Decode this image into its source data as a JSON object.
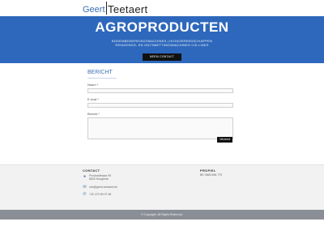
{
  "logo": {
    "first": "Geert",
    "last": "Teetaert"
  },
  "hero": {
    "title": "AGROPRODUCTEN",
    "subtitle_line1": "BODEMBEWERKINGSMACHINES | HOOIGEREEDSCHAPPEN",
    "subtitle_line2": "REINIGINGS- EN ONTSMETTINGSMACHINES CID LINES",
    "button_label": "NEEM CONTACT"
  },
  "form": {
    "title": "BERICHT",
    "name_label": "Naam *",
    "email_label": "E-mail *",
    "message_label": "Bericht *",
    "send_label": "Verzend"
  },
  "footer": {
    "contact_title": "CONTACT",
    "address_line1": "Provinciebaan 99",
    "address_line2": "8830 Hooglede",
    "email": "info@geert-teetaert.be",
    "phone": "+32 479 59 07 66",
    "profile_title": "PROFIEL",
    "vat": "BE 0665.566.775"
  },
  "copyright": "© Copyright. All Rights Reserved.",
  "colors": {
    "accent": "#2e68bc",
    "dark": "#111111",
    "footer_bar": "#8a8e96"
  }
}
